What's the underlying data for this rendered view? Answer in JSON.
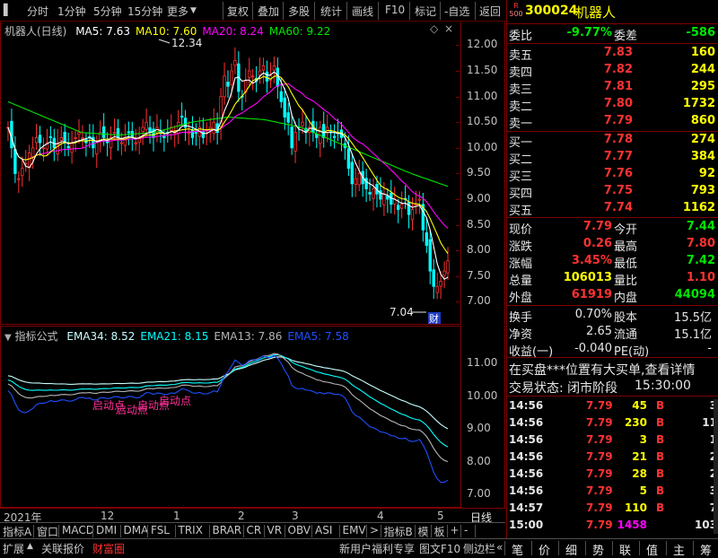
{
  "toolbar": {
    "left": [
      "分时",
      "1分钟",
      "5分钟",
      "15分钟",
      "更多"
    ],
    "right": [
      "复权",
      "叠加",
      "多股",
      "统计",
      "画线",
      "F10",
      "标记",
      "-自选",
      "返回"
    ]
  },
  "stock": {
    "code": "300024",
    "name": "机器人",
    "badge_top": "R",
    "badge_bot": "500"
  },
  "kline": {
    "title": "机器人(日线)",
    "ma": [
      {
        "label": "MA5: 7.63",
        "color": "#ffffff"
      },
      {
        "label": "MA10: 7.60",
        "color": "#ffff00"
      },
      {
        "label": "MA20: 8.24",
        "color": "#ff00ff"
      },
      {
        "label": "MA60: 9.22",
        "color": "#00e600"
      }
    ],
    "high_label": "12.34",
    "low_label": "7.04",
    "cai_label": "财"
  },
  "price_axis": [
    "12.00",
    "11.50",
    "11.00",
    "10.50",
    "10.00",
    "9.50",
    "9.00",
    "8.50",
    "8.00",
    "7.50",
    "7.00"
  ],
  "indicator": {
    "title": "指标公式",
    "ema": [
      {
        "label": "EMA34: 8.52",
        "color": "#c8ffff"
      },
      {
        "label": "EMA21: 8.15",
        "color": "#00ffff"
      },
      {
        "label": "EMA13: 7.86",
        "color": "#b4b4b4"
      },
      {
        "label": "EMA5: 7.58",
        "color": "#1e50ff"
      }
    ],
    "signal": "启动点"
  },
  "ind_axis": [
    "11.00",
    "10.00",
    "9.00",
    "8.00",
    "7.00"
  ],
  "dates": {
    "year": "2021年",
    "months": [
      "12",
      "1",
      "2",
      "3",
      "4",
      "5"
    ],
    "period": "日线"
  },
  "tabs": [
    "指标A",
    "窗口",
    "MACD",
    "DMI",
    "DMA",
    "FSL",
    "TRIX",
    "BRAR",
    "CR",
    "VR",
    "OBV",
    "ASI",
    "EMV",
    ">",
    "指标B",
    "模",
    "板",
    "+",
    "-"
  ],
  "bottombar": {
    "left": [
      "扩展",
      "关联报价",
      "财富圈"
    ],
    "mid": [
      "新用户福利专享",
      "图文F10",
      "侧边栏"
    ],
    "right": [
      "笔",
      "价",
      "细",
      "势",
      "联",
      "值",
      "主",
      "筹"
    ]
  },
  "quote": {
    "wb": {
      "l1": "委比",
      "v1": "-9.77%",
      "l2": "委差",
      "v2": "-586"
    },
    "asks": [
      {
        "l": "卖五",
        "p": "7.83",
        "v": "160"
      },
      {
        "l": "卖四",
        "p": "7.82",
        "v": "244"
      },
      {
        "l": "卖三",
        "p": "7.81",
        "v": "295"
      },
      {
        "l": "卖二",
        "p": "7.80",
        "v": "1732"
      },
      {
        "l": "卖一",
        "p": "7.79",
        "v": "860"
      }
    ],
    "bids": [
      {
        "l": "买一",
        "p": "7.78",
        "v": "274"
      },
      {
        "l": "买二",
        "p": "7.77",
        "v": "384"
      },
      {
        "l": "买三",
        "p": "7.76",
        "v": "92"
      },
      {
        "l": "买四",
        "p": "7.75",
        "v": "793"
      },
      {
        "l": "买五",
        "p": "7.74",
        "v": "1162"
      }
    ],
    "stats": [
      {
        "l1": "现价",
        "v1": "7.79",
        "c1": "red",
        "l2": "今开",
        "v2": "7.44",
        "c2": "grn"
      },
      {
        "l1": "涨跌",
        "v1": "0.26",
        "c1": "red",
        "l2": "最高",
        "v2": "7.80",
        "c2": "red"
      },
      {
        "l1": "涨幅",
        "v1": "3.45%",
        "c1": "red",
        "l2": "最低",
        "v2": "7.42",
        "c2": "grn"
      },
      {
        "l1": "总量",
        "v1": "106013",
        "c1": "yel",
        "l2": "量比",
        "v2": "1.10",
        "c2": "red"
      },
      {
        "l1": "外盘",
        "v1": "61919",
        "c1": "red",
        "l2": "内盘",
        "v2": "44094",
        "c2": "grn"
      }
    ],
    "stats2": [
      {
        "l1": "换手",
        "v1": "0.70%",
        "l2": "股本",
        "v2": "15.5亿"
      },
      {
        "l1": "净资",
        "v1": "2.65",
        "l2": "流通",
        "v2": "15.1亿"
      },
      {
        "l1": "收益(一)",
        "v1": "-0.040",
        "l2": "PE(动)",
        "v2": "-"
      }
    ],
    "notice": "在买盘***位置有大买单,查看详情",
    "status_label": "交易状态: 闭市阶段",
    "status_time": "15:30:00"
  },
  "ticks": [
    {
      "t": "14:56",
      "p": "7.79",
      "v": "45",
      "vc": "yel",
      "d": "B",
      "n": "3"
    },
    {
      "t": "14:56",
      "p": "7.79",
      "v": "230",
      "vc": "yel",
      "d": "B",
      "n": "11"
    },
    {
      "t": "14:56",
      "p": "7.79",
      "v": "3",
      "vc": "yel",
      "d": "B",
      "n": "1"
    },
    {
      "t": "14:56",
      "p": "7.79",
      "v": "21",
      "vc": "yel",
      "d": "B",
      "n": "2"
    },
    {
      "t": "14:56",
      "p": "7.79",
      "v": "28",
      "vc": "yel",
      "d": "B",
      "n": "2"
    },
    {
      "t": "14:56",
      "p": "7.79",
      "v": "5",
      "vc": "yel",
      "d": "B",
      "n": "3"
    },
    {
      "t": "14:57",
      "p": "7.79",
      "v": "110",
      "vc": "yel",
      "d": "B",
      "n": "7"
    },
    {
      "t": "15:00",
      "p": "7.79",
      "v": "1458",
      "vc": "mag",
      "d": "",
      "n": "103"
    }
  ],
  "colors": {
    "up": "#ff3232",
    "down": "#00ffff",
    "frame": "#800000"
  }
}
